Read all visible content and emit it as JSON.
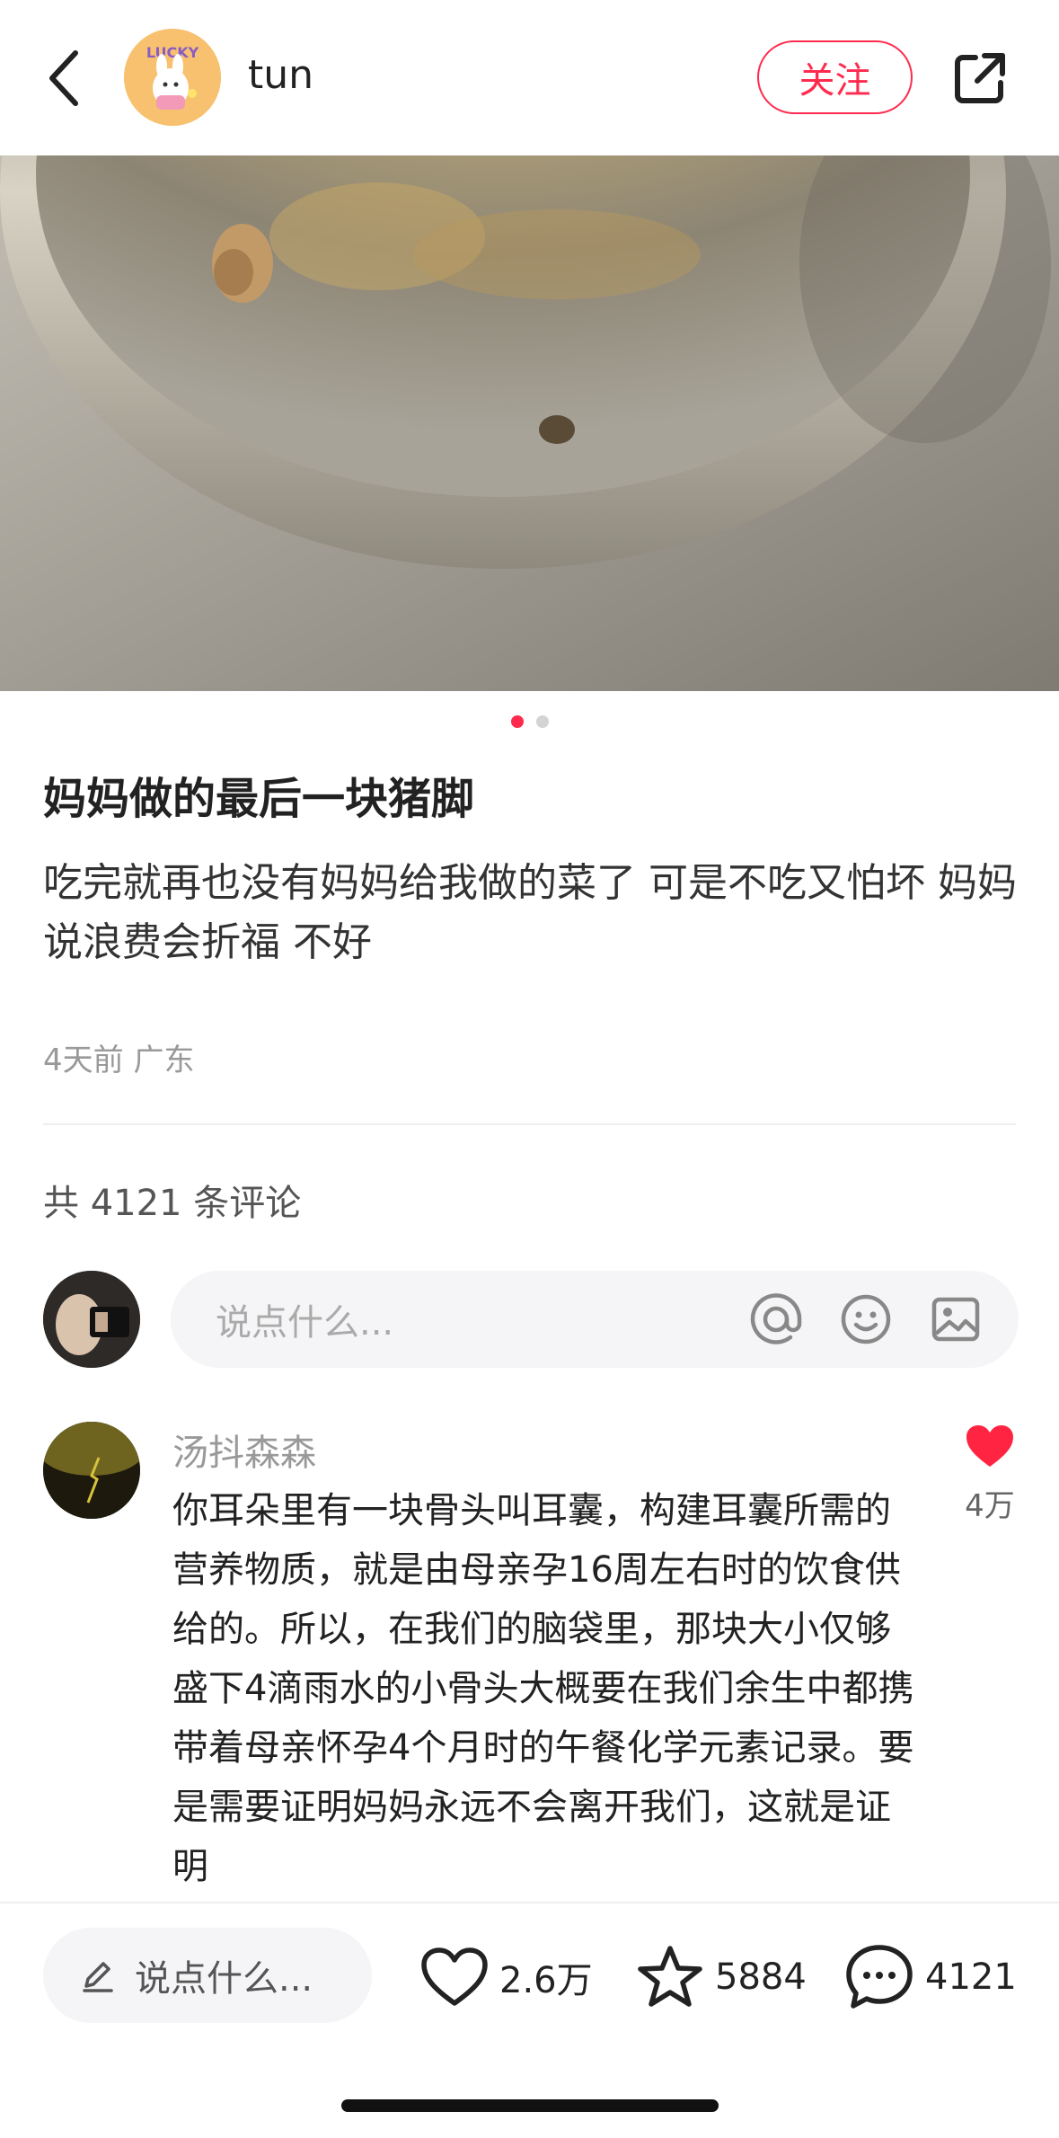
{
  "header": {
    "author_name": "tun",
    "avatar_text": "LUCKY",
    "follow_label": "关注"
  },
  "carousel": {
    "total": 2,
    "current": 1
  },
  "post": {
    "title": "妈妈做的最后一块猪脚",
    "body": "吃完就再也没有妈妈给我做的菜了 可是不吃又怕坏 妈妈说浪费会折福 不好",
    "meta": "4天前 广东"
  },
  "comments_summary": {
    "count_text": "共 4121 条评论"
  },
  "comment_input": {
    "placeholder": "说点什么..."
  },
  "comments": [
    {
      "user": "汤抖森森",
      "text": "你耳朵里有一块骨头叫耳囊，构建耳囊所需的营养物质，就是由母亲孕16周左右时的饮食供给的。所以，在我们的脑袋里，那块大小仅够盛下4滴雨水的小骨头大概要在我们余生中都携带着母亲怀孕4个月时的午餐化学元素记录。要是需要证明妈妈永远不会离开我们，这就是证明",
      "likes": "4万",
      "liked": true
    }
  ],
  "bottom_bar": {
    "input_placeholder": "说点什么...",
    "likes": "2.6万",
    "favorites": "5884",
    "comments": "4121"
  },
  "colors": {
    "accent": "#ff2b4f"
  }
}
